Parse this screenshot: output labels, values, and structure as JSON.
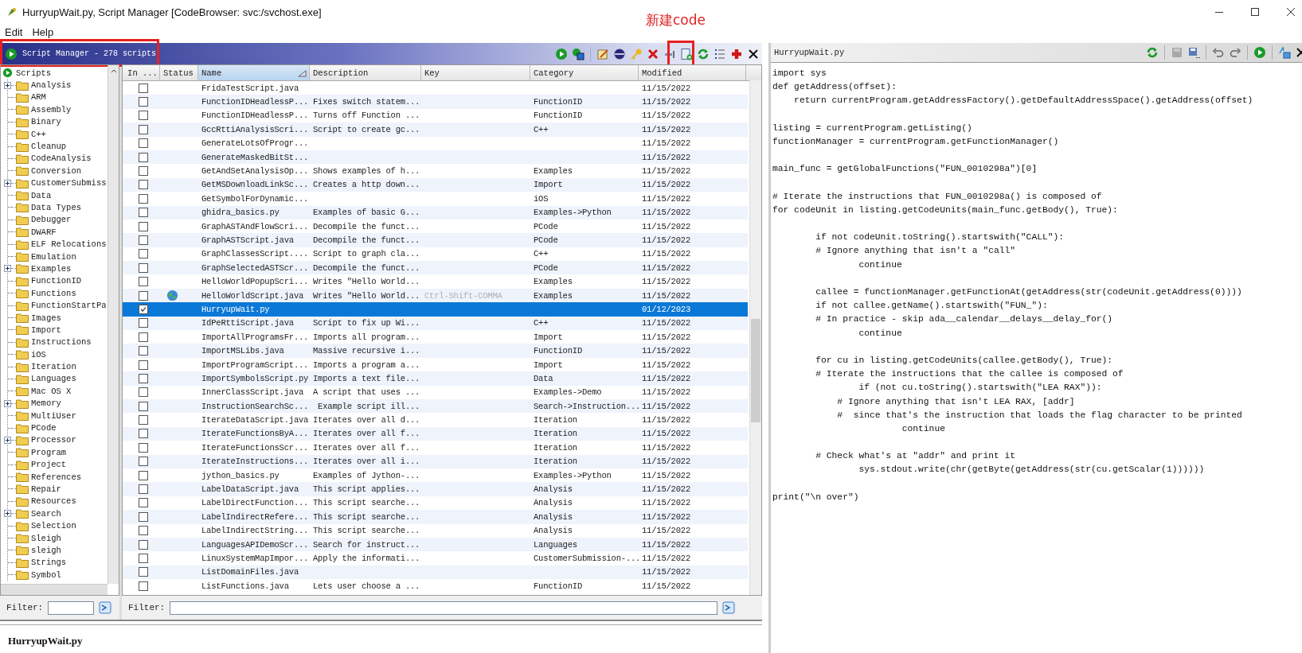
{
  "window": {
    "title": "HurryupWait.py, Script Manager [CodeBrowser: svc:/svchost.exe]"
  },
  "menu": [
    "Edit",
    "Help"
  ],
  "annotation": {
    "text": "新建code"
  },
  "script_manager": {
    "title": "Script Manager - 278 scripts",
    "tree": {
      "root": "Scripts",
      "items": [
        {
          "label": "Analysis",
          "expandable": true
        },
        {
          "label": "ARM",
          "expandable": false
        },
        {
          "label": "Assembly",
          "expandable": false
        },
        {
          "label": "Binary",
          "expandable": false
        },
        {
          "label": "C++",
          "expandable": false
        },
        {
          "label": "Cleanup",
          "expandable": false
        },
        {
          "label": "CodeAnalysis",
          "expandable": false
        },
        {
          "label": "Conversion",
          "expandable": false
        },
        {
          "label": "CustomerSubmiss",
          "expandable": true
        },
        {
          "label": "Data",
          "expandable": false
        },
        {
          "label": "Data Types",
          "expandable": false
        },
        {
          "label": "Debugger",
          "expandable": false
        },
        {
          "label": "DWARF",
          "expandable": false
        },
        {
          "label": "ELF Relocations",
          "expandable": false
        },
        {
          "label": "Emulation",
          "expandable": false
        },
        {
          "label": "Examples",
          "expandable": true
        },
        {
          "label": "FunctionID",
          "expandable": false
        },
        {
          "label": "Functions",
          "expandable": false
        },
        {
          "label": "FunctionStartPa",
          "expandable": false
        },
        {
          "label": "Images",
          "expandable": false
        },
        {
          "label": "Import",
          "expandable": false
        },
        {
          "label": "Instructions",
          "expandable": false
        },
        {
          "label": "iOS",
          "expandable": false
        },
        {
          "label": "Iteration",
          "expandable": false
        },
        {
          "label": "Languages",
          "expandable": false
        },
        {
          "label": "Mac OS X",
          "expandable": false
        },
        {
          "label": "Memory",
          "expandable": true
        },
        {
          "label": "MultiUser",
          "expandable": false
        },
        {
          "label": "PCode",
          "expandable": false
        },
        {
          "label": "Processor",
          "expandable": true
        },
        {
          "label": "Program",
          "expandable": false
        },
        {
          "label": "Project",
          "expandable": false
        },
        {
          "label": "References",
          "expandable": false
        },
        {
          "label": "Repair",
          "expandable": false
        },
        {
          "label": "Resources",
          "expandable": false
        },
        {
          "label": "Search",
          "expandable": true
        },
        {
          "label": "Selection",
          "expandable": false
        },
        {
          "label": "Sleigh",
          "expandable": false
        },
        {
          "label": "sleigh",
          "expandable": false
        },
        {
          "label": "Strings",
          "expandable": false
        },
        {
          "label": "Symbol",
          "expandable": false
        }
      ]
    },
    "tree_filter": {
      "label": "Filter:"
    },
    "table": {
      "columns": [
        {
          "label": "In ...",
          "sorted": false
        },
        {
          "label": "Status",
          "sorted": false
        },
        {
          "label": "Name",
          "sorted": true
        },
        {
          "label": "Description",
          "sorted": false
        },
        {
          "label": "Key",
          "sorted": false
        },
        {
          "label": "Category",
          "sorted": false
        },
        {
          "label": "Modified",
          "sorted": false
        }
      ],
      "rows": [
        {
          "checked": false,
          "selected": false,
          "status_icon": false,
          "name": "FridaTestScript.java",
          "modified": "11/15/2022"
        },
        {
          "checked": false,
          "selected": false,
          "status_icon": false,
          "name": "FunctionIDHeadlessP...",
          "description": "Fixes switch statem...",
          "category": "FunctionID",
          "modified": "11/15/2022"
        },
        {
          "checked": false,
          "selected": false,
          "status_icon": false,
          "name": "FunctionIDHeadlessP...",
          "description": "Turns off Function ...",
          "category": "FunctionID",
          "modified": "11/15/2022"
        },
        {
          "checked": false,
          "selected": false,
          "status_icon": false,
          "name": "GccRttiAnalysisScri...",
          "description": "Script to create gc...",
          "category": "C++",
          "modified": "11/15/2022"
        },
        {
          "checked": false,
          "selected": false,
          "status_icon": false,
          "name": "GenerateLotsOfProgr...",
          "modified": "11/15/2022"
        },
        {
          "checked": false,
          "selected": false,
          "status_icon": false,
          "name": "GenerateMaskedBitSt...",
          "modified": "11/15/2022"
        },
        {
          "checked": false,
          "selected": false,
          "status_icon": false,
          "name": "GetAndSetAnalysisOp...",
          "description": "Shows examples of h...",
          "category": "Examples",
          "modified": "11/15/2022"
        },
        {
          "checked": false,
          "selected": false,
          "status_icon": false,
          "name": "GetMSDownloadLinkSc...",
          "description": "Creates a http down...",
          "category": "Import",
          "modified": "11/15/2022"
        },
        {
          "checked": false,
          "selected": false,
          "status_icon": false,
          "name": "GetSymbolForDynamic...",
          "category": "iOS",
          "modified": "11/15/2022"
        },
        {
          "checked": false,
          "selected": false,
          "status_icon": false,
          "name": "ghidra_basics.py",
          "description": "Examples of basic G...",
          "category": "Examples->Python",
          "modified": "11/15/2022"
        },
        {
          "checked": false,
          "selected": false,
          "status_icon": false,
          "name": "GraphASTAndFlowScri...",
          "description": "Decompile the funct...",
          "category": "PCode",
          "modified": "11/15/2022"
        },
        {
          "checked": false,
          "selected": false,
          "status_icon": false,
          "name": "GraphASTScript.java",
          "description": "Decompile the funct...",
          "category": "PCode",
          "modified": "11/15/2022"
        },
        {
          "checked": false,
          "selected": false,
          "status_icon": false,
          "name": "GraphClassesScript....",
          "description": "Script to graph cla...",
          "category": "C++",
          "modified": "11/15/2022"
        },
        {
          "checked": false,
          "selected": false,
          "status_icon": false,
          "name": "GraphSelectedASTScr...",
          "description": "Decompile the funct...",
          "category": "PCode",
          "modified": "11/15/2022"
        },
        {
          "checked": false,
          "selected": false,
          "status_icon": false,
          "name": "HelloWorldPopupScri...",
          "description": "Writes \"Hello World...",
          "category": "Examples",
          "modified": "11/15/2022"
        },
        {
          "checked": false,
          "selected": false,
          "status_icon": true,
          "name": "HelloWorldScript.java",
          "description": "Writes \"Hello World...",
          "key": "Ctrl-Shift-COMMA",
          "category": "Examples",
          "modified": "11/15/2022"
        },
        {
          "checked": true,
          "selected": true,
          "status_icon": false,
          "name": "HurryupWait.py",
          "modified": "01/12/2023"
        },
        {
          "checked": false,
          "selected": false,
          "status_icon": false,
          "name": "IdPeRttiScript.java",
          "description": "Script to fix up Wi...",
          "category": "C++",
          "modified": "11/15/2022"
        },
        {
          "checked": false,
          "selected": false,
          "status_icon": false,
          "name": "ImportAllProgramsFr...",
          "description": "Imports all program...",
          "category": "Import",
          "modified": "11/15/2022"
        },
        {
          "checked": false,
          "selected": false,
          "status_icon": false,
          "name": "ImportMSLibs.java",
          "description": "Massive recursive i...",
          "category": "FunctionID",
          "modified": "11/15/2022"
        },
        {
          "checked": false,
          "selected": false,
          "status_icon": false,
          "name": "ImportProgramScript...",
          "description": "Imports a program a...",
          "category": "Import",
          "modified": "11/15/2022"
        },
        {
          "checked": false,
          "selected": false,
          "status_icon": false,
          "name": "ImportSymbolsScript.py",
          "description": "Imports a text file...",
          "category": "Data",
          "modified": "11/15/2022"
        },
        {
          "checked": false,
          "selected": false,
          "status_icon": false,
          "name": "InnerClassScript.java",
          "description": "A script that uses ...",
          "category": "Examples->Demo",
          "modified": "11/15/2022"
        },
        {
          "checked": false,
          "selected": false,
          "status_icon": false,
          "name": "InstructionSearchSc...",
          "description": " Example script ill...",
          "category": "Search->Instruction...",
          "modified": "11/15/2022"
        },
        {
          "checked": false,
          "selected": false,
          "status_icon": false,
          "name": "IterateDataScript.java",
          "description": "Iterates over all d...",
          "category": "Iteration",
          "modified": "11/15/2022"
        },
        {
          "checked": false,
          "selected": false,
          "status_icon": false,
          "name": "IterateFunctionsByA...",
          "description": "Iterates over all f...",
          "category": "Iteration",
          "modified": "11/15/2022"
        },
        {
          "checked": false,
          "selected": false,
          "status_icon": false,
          "name": "IterateFunctionsScr...",
          "description": "Iterates over all f...",
          "category": "Iteration",
          "modified": "11/15/2022"
        },
        {
          "checked": false,
          "selected": false,
          "status_icon": false,
          "name": "IterateInstructions...",
          "description": "Iterates over all i...",
          "category": "Iteration",
          "modified": "11/15/2022"
        },
        {
          "checked": false,
          "selected": false,
          "status_icon": false,
          "name": "jython_basics.py",
          "description": "Examples of Jython-...",
          "category": "Examples->Python",
          "modified": "11/15/2022"
        },
        {
          "checked": false,
          "selected": false,
          "status_icon": false,
          "name": "LabelDataScript.java",
          "description": "This script applies...",
          "category": "Analysis",
          "modified": "11/15/2022"
        },
        {
          "checked": false,
          "selected": false,
          "status_icon": false,
          "name": "LabelDirectFunction...",
          "description": "This script searche...",
          "category": "Analysis",
          "modified": "11/15/2022"
        },
        {
          "checked": false,
          "selected": false,
          "status_icon": false,
          "name": "LabelIndirectRefere...",
          "description": "This script searche...",
          "category": "Analysis",
          "modified": "11/15/2022"
        },
        {
          "checked": false,
          "selected": false,
          "status_icon": false,
          "name": "LabelIndirectString...",
          "description": "This script searche...",
          "category": "Analysis",
          "modified": "11/15/2022"
        },
        {
          "checked": false,
          "selected": false,
          "status_icon": false,
          "name": "LanguagesAPIDemoScr...",
          "description": "Search for instruct...",
          "category": "Languages",
          "modified": "11/15/2022"
        },
        {
          "checked": false,
          "selected": false,
          "status_icon": false,
          "name": "LinuxSystemMapImpor...",
          "description": "Apply the informati...",
          "category": "CustomerSubmission-...",
          "modified": "11/15/2022"
        },
        {
          "checked": false,
          "selected": false,
          "status_icon": false,
          "name": "ListDomainFiles.java",
          "modified": "11/15/2022"
        },
        {
          "checked": false,
          "selected": false,
          "status_icon": false,
          "name": "ListFunctions.java",
          "description": "Lets user choose a ...",
          "category": "FunctionID",
          "modified": "11/15/2022"
        }
      ]
    },
    "filter": {
      "label": "Filter:"
    }
  },
  "details": {
    "title": "HurryupWait.py"
  },
  "editor": {
    "title": "HurryupWait.py",
    "blocks": [
      [
        "import sys",
        "def getAddress(offset):",
        "    return currentProgram.getAddressFactory().getDefaultAddressSpace().getAddress(offset)"
      ],
      [
        "listing = currentProgram.getListing()",
        "functionManager = currentProgram.getFunctionManager()"
      ],
      [
        "main_func = getGlobalFunctions(\"FUN_0010298a\")[0]"
      ],
      [
        "# Iterate the instructions that FUN_0010298a() is composed of",
        "for codeUnit in listing.getCodeUnits(main_func.getBody(), True):"
      ],
      [
        "        if not codeUnit.toString().startswith(\"CALL\"):",
        "        # Ignore anything that isn't a \"call\"",
        "                continue"
      ],
      [
        "        callee = functionManager.getFunctionAt(getAddress(str(codeUnit.getAddress(0))))",
        "        if not callee.getName().startswith(\"FUN_\"):",
        "        # In practice - skip ada__calendar__delays__delay_for()",
        "                continue"
      ],
      [
        "        for cu in listing.getCodeUnits(callee.getBody(), True):",
        "        # Iterate the instructions that the callee is composed of",
        "                if (not cu.toString().startswith(\"LEA RAX\")):",
        "            # Ignore anything that isn't LEA RAX, [addr]",
        "            #  since that's the instruction that loads the flag character to be printed",
        "                        continue"
      ],
      [
        "        # Check what's at \"addr\" and print it",
        "                sys.stdout.write(chr(getByte(getAddress(str(cu.getScalar(1))))))"
      ],
      [
        "print(\"\\n over\")"
      ]
    ]
  }
}
